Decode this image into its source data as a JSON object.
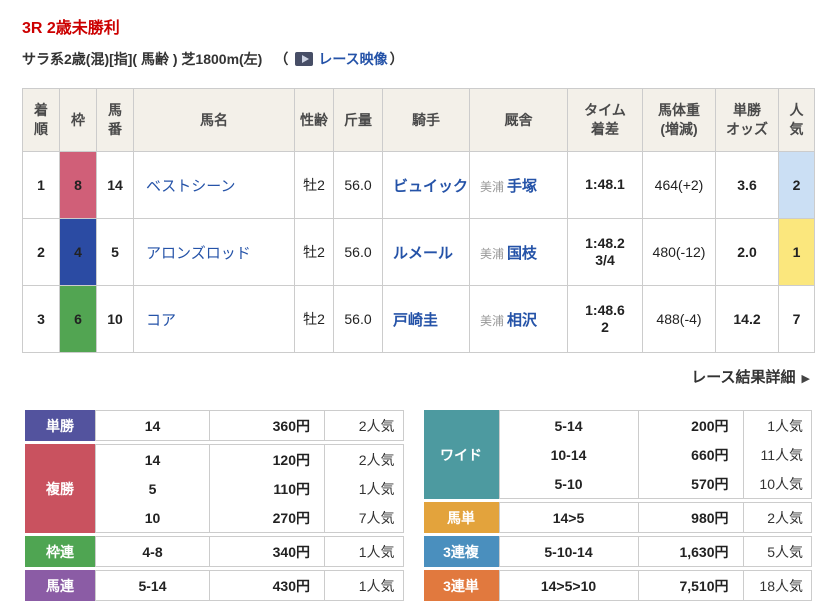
{
  "page": {
    "title": "3R 2歳未勝利",
    "conditions": "サラ系2歳(混)[指]( 馬齢 ) 芝1800m(左)",
    "paren_open": "（",
    "video_link_label": "レース映像",
    "paren_close": "）"
  },
  "detail_link": {
    "label": "レース結果詳細",
    "arrow": "▶"
  },
  "results_table": {
    "headers": {
      "finish_l1": "着",
      "finish_l2": "順",
      "frame": "枠",
      "number_l1": "馬",
      "number_l2": "番",
      "horse": "馬名",
      "sex_age": "性齢",
      "weight": "斤量",
      "jockey": "騎手",
      "stable": "厩舎",
      "time_l1": "タイム",
      "time_l2": "着差",
      "body_weight_l1": "馬体重",
      "body_weight_l2": "(増減)",
      "odds_l1": "単勝",
      "odds_l2": "オッズ",
      "pop_l1": "人",
      "pop_l2": "気"
    },
    "rows": [
      {
        "finish": "1",
        "frame": "8",
        "number": "14",
        "horse": "ベストシーン",
        "sex_age": "牡2",
        "weight": "56.0",
        "jockey": "ビュイック",
        "region": "美浦",
        "trainer": "手塚",
        "time": "1:48.1",
        "margin": "",
        "body_weight": "464(+2)",
        "odds": "3.6",
        "popularity": "2"
      },
      {
        "finish": "2",
        "frame": "4",
        "number": "5",
        "horse": "アロンズロッド",
        "sex_age": "牡2",
        "weight": "56.0",
        "jockey": "ルメール",
        "region": "美浦",
        "trainer": "国枝",
        "time": "1:48.2",
        "margin": "3/4",
        "body_weight": "480(-12)",
        "odds": "2.0",
        "popularity": "1"
      },
      {
        "finish": "3",
        "frame": "6",
        "number": "10",
        "horse": "コア",
        "sex_age": "牡2",
        "weight": "56.0",
        "jockey": "戸崎圭",
        "region": "美浦",
        "trainer": "相沢",
        "time": "1:48.6",
        "margin": "2",
        "body_weight": "488(-4)",
        "odds": "14.2",
        "popularity": "7"
      }
    ]
  },
  "payouts": {
    "left": [
      {
        "type": "単勝",
        "rows": [
          {
            "sel": "14",
            "amount": "360円",
            "pop": "2人気"
          }
        ]
      },
      {
        "type": "複勝",
        "rows": [
          {
            "sel": "14",
            "amount": "120円",
            "pop": "2人気"
          },
          {
            "sel": "5",
            "amount": "110円",
            "pop": "1人気"
          },
          {
            "sel": "10",
            "amount": "270円",
            "pop": "7人気"
          }
        ]
      },
      {
        "type": "枠連",
        "rows": [
          {
            "sel": "4-8",
            "amount": "340円",
            "pop": "1人気"
          }
        ]
      },
      {
        "type": "馬連",
        "rows": [
          {
            "sel": "5-14",
            "amount": "430円",
            "pop": "1人気"
          }
        ]
      }
    ],
    "right": [
      {
        "type": "ワイド",
        "rows": [
          {
            "sel": "5-14",
            "amount": "200円",
            "pop": "1人気"
          },
          {
            "sel": "10-14",
            "amount": "660円",
            "pop": "11人気"
          },
          {
            "sel": "5-10",
            "amount": "570円",
            "pop": "10人気"
          }
        ]
      },
      {
        "type": "馬単",
        "rows": [
          {
            "sel": "14>5",
            "amount": "980円",
            "pop": "2人気"
          }
        ]
      },
      {
        "type": "3連複",
        "rows": [
          {
            "sel": "5-10-14",
            "amount": "1,630円",
            "pop": "5人気"
          }
        ]
      },
      {
        "type": "3連単",
        "rows": [
          {
            "sel": "14>5>10",
            "amount": "7,510円",
            "pop": "18人気"
          }
        ]
      }
    ]
  },
  "colors": {
    "title_red": "#cc0000",
    "link_blue": "#2553a8",
    "header_bg": "#f3f0e9",
    "frame_8": "#d05f78",
    "frame_4": "#2b4ba3",
    "frame_6": "#52a552",
    "pop_1_bg": "#fbe77d",
    "pop_2_bg": "#cbdff4",
    "bet_tansho": "#53539e",
    "bet_fukusho": "#c9525f",
    "bet_wakuren": "#4fa552",
    "bet_umaren": "#8b5ca5",
    "bet_wide": "#4d9aa0",
    "bet_umatan": "#e3a33c",
    "bet_sanrenpuku": "#4a8fbe",
    "bet_sanrentan": "#e1793e"
  }
}
